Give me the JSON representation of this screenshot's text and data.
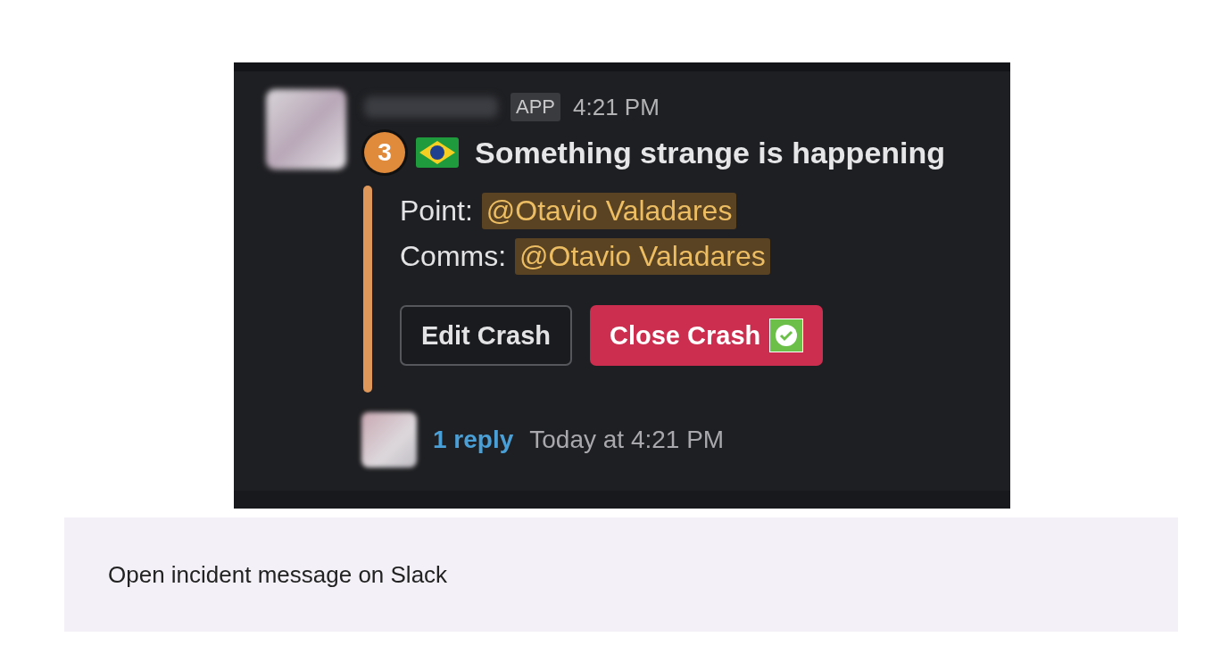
{
  "message": {
    "app_badge": "APP",
    "time": "4:21 PM",
    "incident_number": "3",
    "title": "Something strange is happening",
    "fields": [
      {
        "label": "Point:",
        "mention": "@Otavio Valadares"
      },
      {
        "label": "Comms:",
        "mention": "@Otavio Valadares"
      }
    ],
    "buttons": [
      {
        "label": "Edit Crash",
        "kind": "secondary"
      },
      {
        "label": "Close Crash",
        "kind": "danger"
      }
    ],
    "thread": {
      "replies": "1 reply",
      "timestamp": "Today at 4:21 PM"
    }
  },
  "caption": "Open incident message on Slack"
}
